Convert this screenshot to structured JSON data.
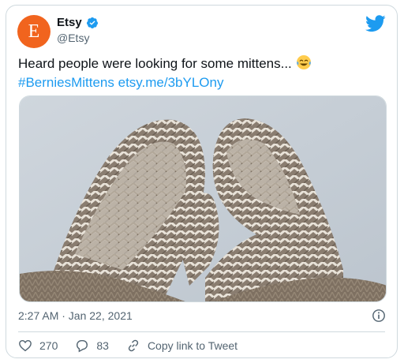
{
  "account": {
    "avatar_letter": "E",
    "name": "Etsy",
    "handle": "@Etsy",
    "brand_color": "#f1641e"
  },
  "tweet": {
    "text": "Heard people were looking for some mittens...",
    "emoji": "face-with-tears-of-joy",
    "hashtag": "#BerniesMittens",
    "link": "etsy.me/3bYLOny",
    "media_alt": "photo of brown and cream knitted mittens",
    "timestamp": "2:27 AM · Jan 22, 2021"
  },
  "actions": {
    "like_count": "270",
    "reply_count": "83",
    "copy_link_label": "Copy link to Tweet"
  },
  "colors": {
    "link": "#1d9bf0",
    "secondary_text": "#536471",
    "border": "#cfd9de"
  }
}
